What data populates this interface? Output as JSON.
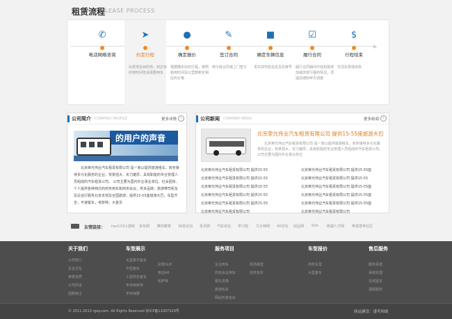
{
  "process": {
    "title": "租赁流程",
    "subtitle": "LEASE PROCESS",
    "steps": [
      {
        "name": "电话网络咨询",
        "icon": "phone-icon",
        "desc": ""
      },
      {
        "name": "约定行程",
        "icon": "location-arrow-icon",
        "desc": "出发地及目的地，到达目的地时间告诉需要用车"
      },
      {
        "name": "确定报价",
        "icon": "person-icon",
        "desc": "根据确定好的行程，按照租用时间及公里数制定相应的价格"
      },
      {
        "name": "签订合同",
        "icon": "contract-icon",
        "desc": "电子版合同或上门签订"
      },
      {
        "name": "确定车辆信息",
        "icon": "bus-icon",
        "desc": "发车前司机信息及车牌号"
      },
      {
        "name": "履行合同",
        "icon": "checklist-icon",
        "desc": "履行合同期间中途如需增加或改变行程的情况，须提前通知甲方调度"
      },
      {
        "name": "行程结束",
        "icon": "dollar-icon",
        "desc": "付清车费或余款"
      }
    ]
  },
  "intro": {
    "title": "公司简介",
    "en": "COMPANY PROFILE",
    "more": "更多详情",
    "banner": "的用户的声音",
    "text": "北京荣光伟业汽车租赁有限公司 是一家以提供旅游租车，商务接待多元化服务的企业，背景强大、实力雄厚，具有职能的专业管理人员组成的汽车租赁公司。 公司主要为国内外企事业单位、社会团体、个人提供各种档次的商务用车和商务会议，供多品牌，旅游带司机车及近远行服务北京本地及全国旅游，提供15-55座旅游大巴，车型齐全，平速客车，考斯特，大金龙"
  },
  "news": {
    "title": "公司新闻",
    "en": "COMPANY NEWS",
    "more": "更多新闻",
    "headline": "北京荣光伟业汽车租赁有限公司 提供15-55座旅游大巴",
    "summary": "北京荣光伟业汽车租赁有限公司 是一家以提供旅游租车，商务接待多元化服务的企业，背景强大、实力雄厚，具有职能的专业管理人员组成的汽车租赁公司。 公司主要为国内外企事业单位",
    "items": [
      "北京荣光伟业汽车租赁有限公司 提供15-55",
      "北京荣光伟业汽车租赁有限公司 提供15-55座",
      "北京荣光伟业汽车租赁有限公司 提供15-55",
      "北京荣光伟业汽车租赁有限公司 提供15-55",
      "北京荣光伟业汽车租赁有限公司 提供15-55",
      "北京荣光伟业汽车租赁有限公司 提供15-55座",
      "北京荣光伟业汽车租赁有限公司 提供15-55",
      "北京荣光伟业汽车租赁有限公司 提供15-55座",
      "北京荣光伟业汽车租赁有限公司 提供15-55",
      "北京荣光伟业汽车租赁有限公司 提供15-55座",
      "北京荣光伟业汽车租赁有限公司",
      "北京荣光伟业汽车租赁有限公司"
    ]
  },
  "links": {
    "label": "友情链接：",
    "items": [
      "hao123小游戏",
      "京东网",
      "腾讯教育",
      "36氪论坛",
      "车讯网",
      "汽车论坛",
      "学习啦",
      "几分钟网",
      "40论坛",
      "创业网",
      "Site",
      "新疆人才网",
      "英语雪帝社区"
    ]
  },
  "footer": {
    "cols": [
      {
        "title": "关于我们",
        "items": [
          "公司简介",
          "企业文化",
          "荣誉资质",
          "公司风采",
          "招聘纳士"
        ]
      },
      {
        "title": "车型展示",
        "items": [
          "大型豪华客车",
          "中型客车",
          "小型商务客车",
          "丰田考斯特",
          "丰田海狮",
          "别克GL8",
          "奥迪A6",
          "帕萨特"
        ]
      },
      {
        "title": "服务项目",
        "items": [
          "企业用车",
          "商务会议用车",
          "婚礼庆典",
          "旅游包车",
          "网站形象包车",
          "机场接送",
          "商务包车"
        ]
      },
      {
        "title": "车型报价",
        "items": [
          "商务车型",
          "大型客车"
        ]
      },
      {
        "title": "售后服务",
        "items": [
          "服务承诺",
          "事故处理",
          "在线留言",
          "视频服务"
        ]
      }
    ],
    "copyright": "© 2011-2013 rgey.com. All Rights Reserved 京ICP备11007329号",
    "builder": "网站建设：谨号网络"
  }
}
